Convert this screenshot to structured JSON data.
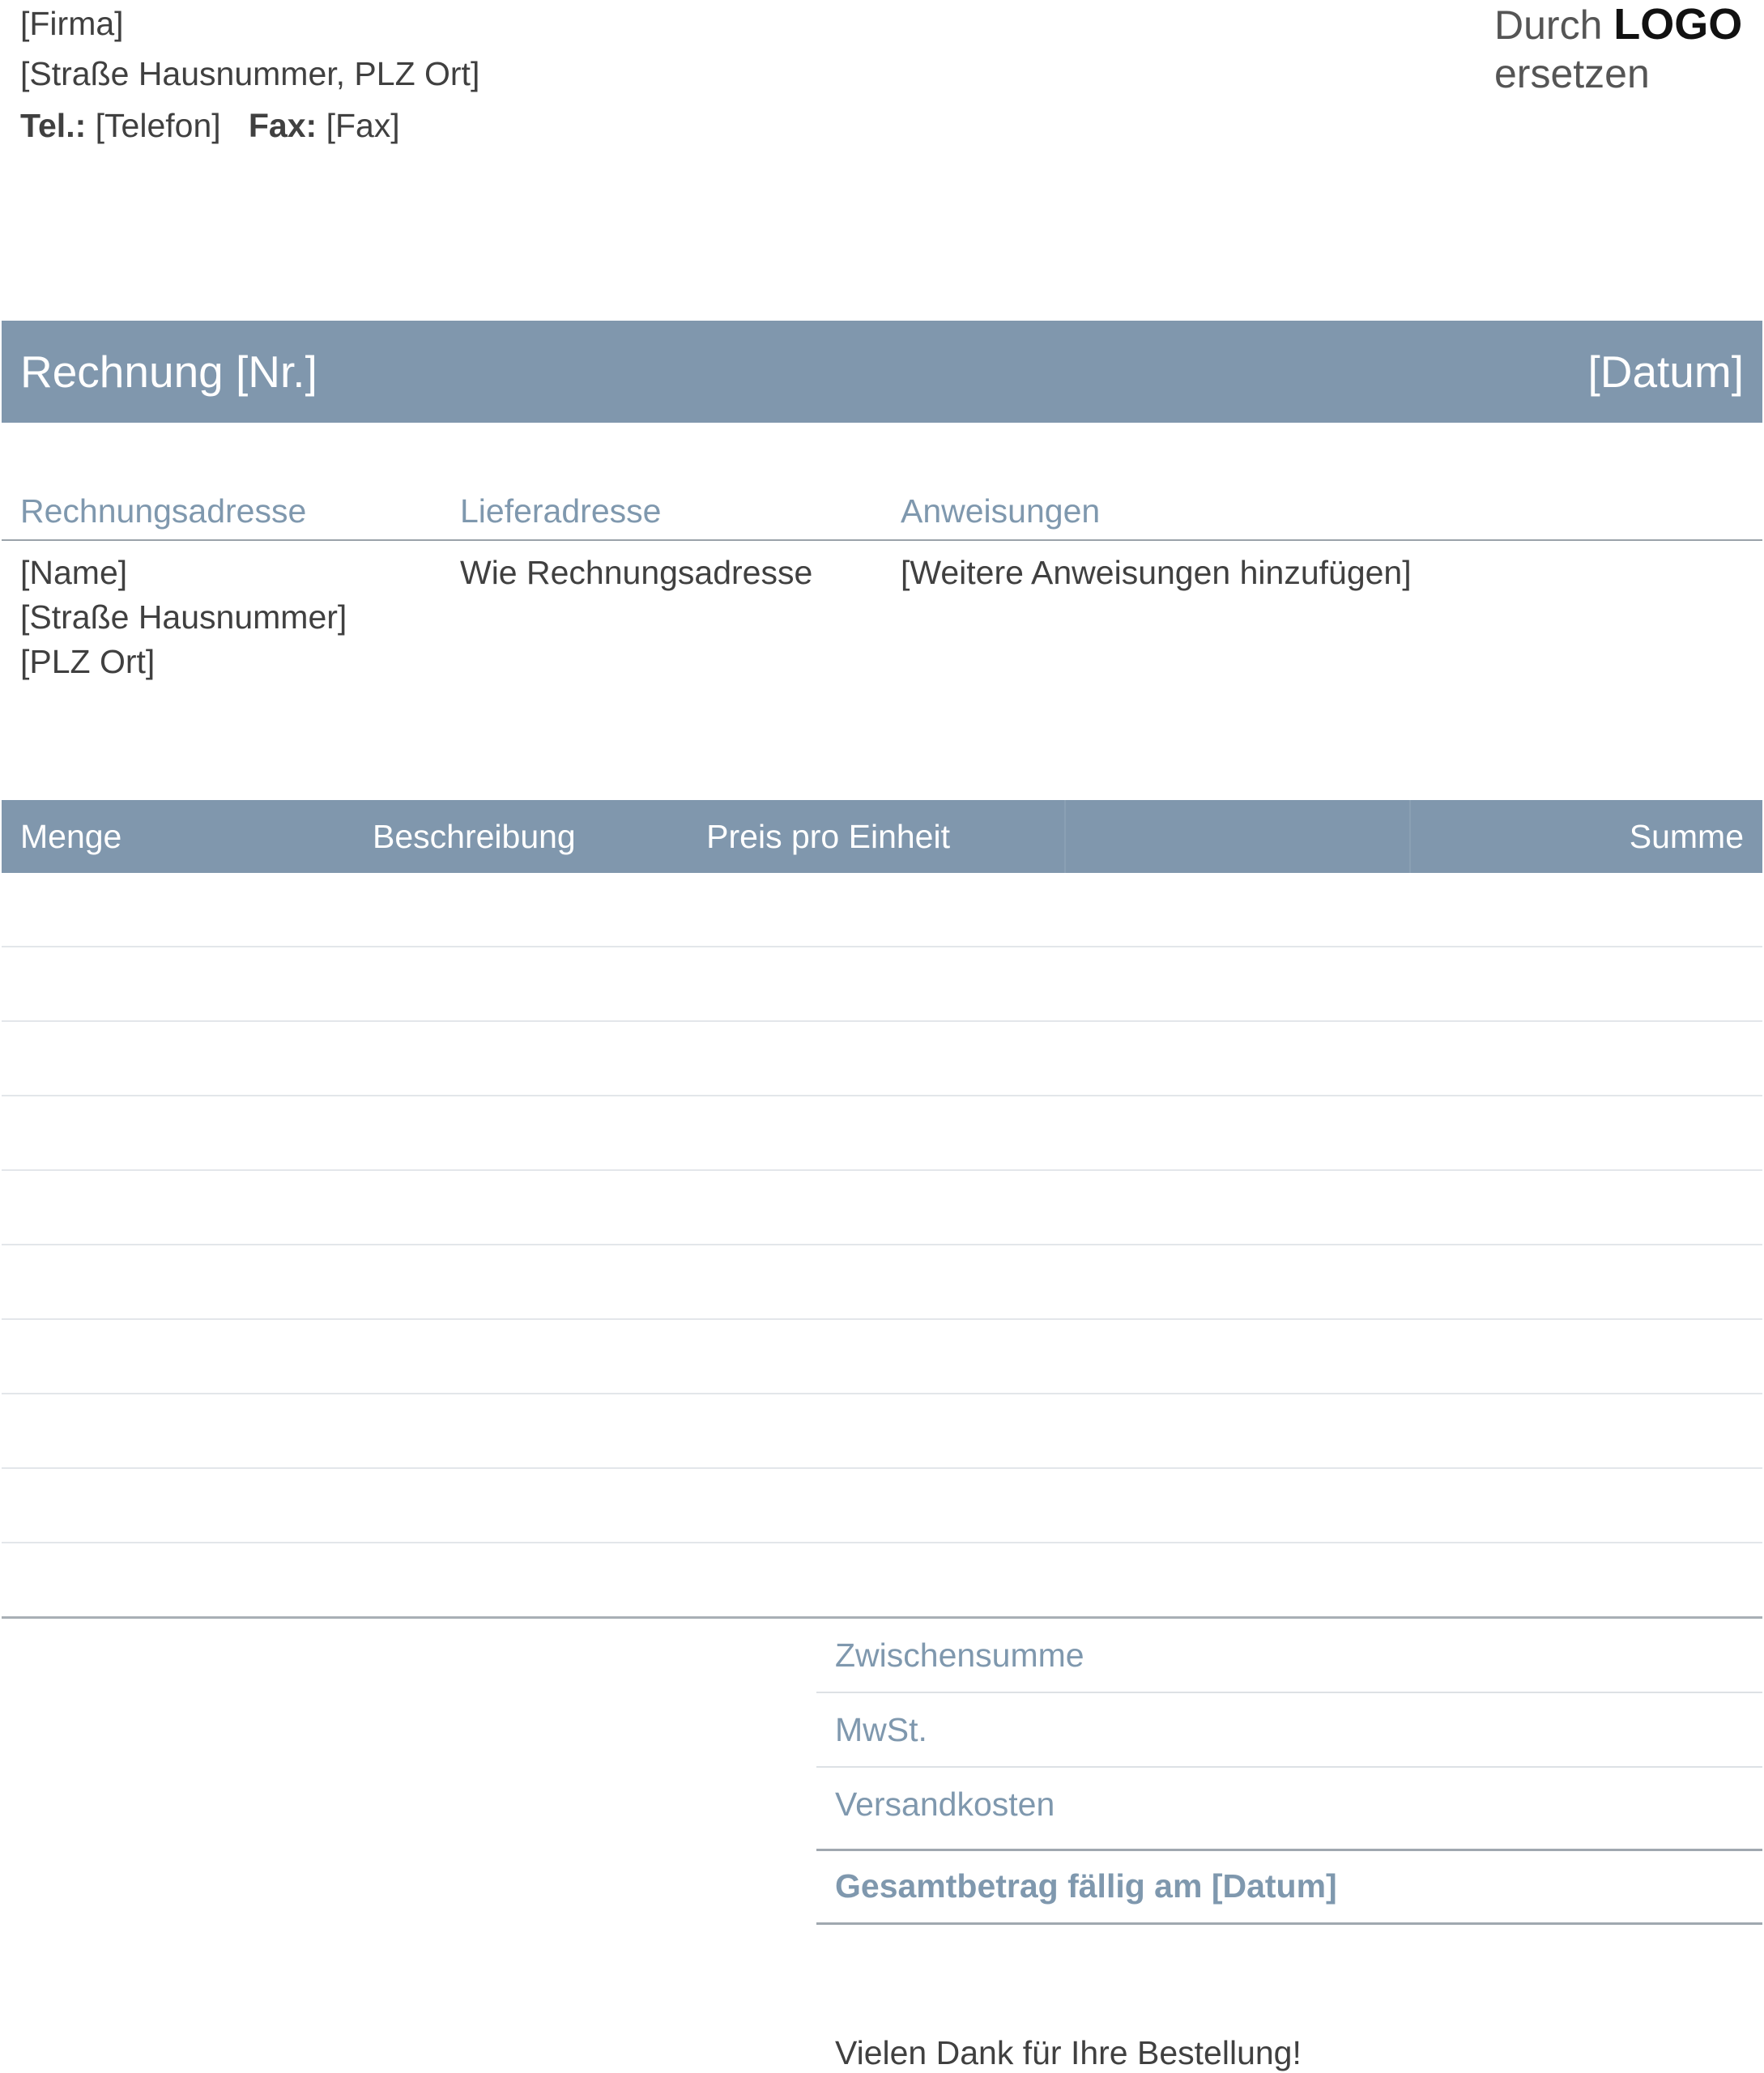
{
  "company": {
    "name": "[Firma]",
    "address": "[Straße Hausnummer, PLZ Ort]",
    "tel_label": "Tel.:",
    "tel_value": "[Telefon]",
    "fax_label": "Fax:",
    "fax_value": "[Fax]"
  },
  "logo": {
    "prefix": "Durch",
    "strong": "LOGO",
    "suffix": "ersetzen"
  },
  "invoice": {
    "title": "Rechnung [Nr.]",
    "date": "[Datum]"
  },
  "addresses": {
    "billing_heading": "Rechnungsadresse",
    "shipping_heading": "Lieferadresse",
    "instructions_heading": "Anweisungen",
    "billing_name": "[Name]",
    "billing_street": "[Straße Hausnummer]",
    "billing_city": "[PLZ Ort]",
    "shipping_value": "Wie Rechnungsadresse",
    "instructions_value": "[Weitere Anweisungen hinzufügen]"
  },
  "items_table": {
    "columns": [
      "Menge",
      "Beschreibung",
      "Preis pro Einheit",
      "Summe"
    ]
  },
  "totals": {
    "subtotal_label": "Zwischensumme",
    "tax_label": "MwSt.",
    "shipping_label": "Versandkosten",
    "grand_total_label": "Gesamtbetrag fällig am [Datum]"
  },
  "footer": {
    "thanks": "Vielen Dank für Ihre Bestellung!"
  },
  "colors": {
    "accent": "#8097ad",
    "accent_text": "#7f98ae",
    "body_text": "#404040"
  }
}
